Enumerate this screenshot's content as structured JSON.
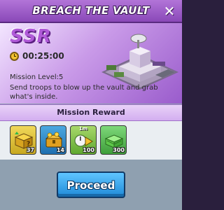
{
  "window": {
    "title": "BREACH THE VAULT",
    "close_icon": "close-icon"
  },
  "mission": {
    "rarity": "SSR",
    "timer": "00:25:00",
    "level_text": "Mission Level:5",
    "description": "Send troops to blow up the vault and grab what's inside."
  },
  "reward_section": {
    "title": "Mission Reward",
    "rewards": [
      {
        "icon": "mystery-box-icon",
        "count": "37",
        "top_label": ""
      },
      {
        "icon": "gold-chest-icon",
        "count": "14",
        "top_label": ""
      },
      {
        "icon": "speedup-icon",
        "count": "100",
        "top_label": "1m"
      },
      {
        "icon": "cash-stack-icon",
        "count": "300",
        "top_label": ""
      }
    ]
  },
  "actions": {
    "proceed_label": "Proceed"
  },
  "colors": {
    "title_bar": "#9a5ccc",
    "rarity": "#b05ad8",
    "proceed_button": "#1f8ad8"
  }
}
